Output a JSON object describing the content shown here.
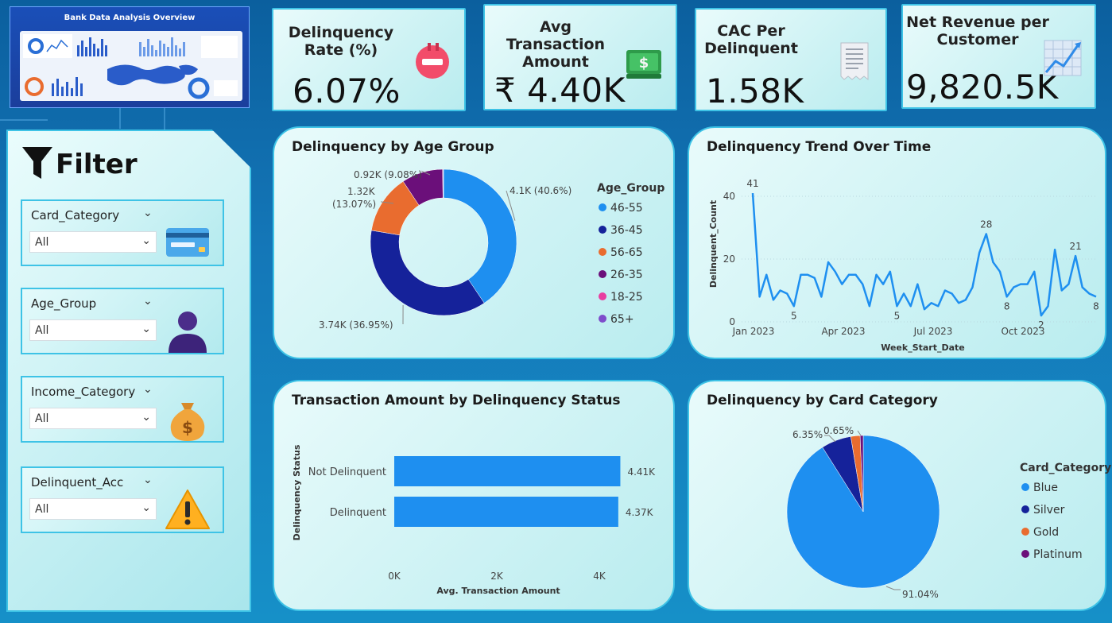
{
  "colors": {
    "blue": "#1e8ff0",
    "navy": "#15229a",
    "orange": "#e96c2f",
    "purple": "#6b0f7a",
    "pink": "#e83ea0",
    "violet": "#7e4ccb",
    "line": "#1e8ff0"
  },
  "thumbnail": {
    "title": "Bank Data Analysis Overview"
  },
  "kpis": [
    {
      "title": "Delinquency Rate (%)",
      "value": "6.07%",
      "icon": "calendar-remove-icon"
    },
    {
      "title": "Avg Transaction Amount",
      "value": "₹ 4.40K",
      "icon": "money-icon"
    },
    {
      "title": "CAC Per Delinquent",
      "value": "1.58K",
      "icon": "receipt-icon"
    },
    {
      "title": "Net Revenue per Customer",
      "value": "9,820.5K",
      "icon": "growth-chart-icon"
    }
  ],
  "filter": {
    "title": "Filter",
    "slicers": [
      {
        "label": "Card_Category",
        "value": "All",
        "icon": "credit-card-icon"
      },
      {
        "label": "Age_Group",
        "value": "All",
        "icon": "person-icon"
      },
      {
        "label": "Income_Category",
        "value": "All",
        "icon": "money-bag-icon"
      },
      {
        "label": "Delinquent_Acc",
        "value": "All",
        "icon": "warning-icon"
      }
    ]
  },
  "chart_data": [
    {
      "type": "donut",
      "title": "Delinquency by Age Group",
      "legend_title": "Age_Group",
      "legend_position": "right",
      "categories": [
        "46-55",
        "36-45",
        "56-65",
        "26-35",
        "18-25",
        "65+"
      ],
      "values": [
        4.1,
        3.74,
        1.32,
        0.92,
        0.01,
        0.01
      ],
      "value_unit": "K",
      "labels": [
        "4.1K (40.6%)",
        "3.74K (36.95%)",
        "1.32K (13.07%)",
        "0.92K (9.08%)",
        "",
        ""
      ],
      "colors": [
        "#1e8ff0",
        "#15229a",
        "#e96c2f",
        "#6b0f7a",
        "#e83ea0",
        "#7e4ccb"
      ]
    },
    {
      "type": "line",
      "title": "Delinquency Trend Over Time",
      "xlabel": "Week_Start_Date",
      "ylabel": "Delinquent_Count",
      "x_ticks": [
        "Jan 2023",
        "Apr 2023",
        "Jul 2023",
        "Oct 2023"
      ],
      "y_ticks": [
        "0",
        "20",
        "40"
      ],
      "ylim": [
        0,
        45
      ],
      "values": [
        41,
        8,
        15,
        7,
        10,
        9,
        5,
        15,
        15,
        14,
        8,
        19,
        16,
        12,
        15,
        15,
        12,
        5,
        15,
        12,
        16,
        5,
        9,
        5,
        12,
        4,
        6,
        5,
        10,
        9,
        6,
        7,
        11,
        22,
        28,
        19,
        16,
        8,
        11,
        12,
        12,
        16,
        2,
        5,
        23,
        10,
        12,
        21,
        11,
        9,
        8
      ],
      "point_labels": [
        {
          "index": 0,
          "text": "41"
        },
        {
          "index": 6,
          "text": "5"
        },
        {
          "index": 21,
          "text": "5"
        },
        {
          "index": 34,
          "text": "28"
        },
        {
          "index": 37,
          "text": "8"
        },
        {
          "index": 42,
          "text": "2"
        },
        {
          "index": 47,
          "text": "21"
        },
        {
          "index": 50,
          "text": "8"
        }
      ]
    },
    {
      "type": "bar",
      "orientation": "horizontal",
      "title": "Transaction Amount by Delinquency Status",
      "xlabel": "Avg. Transaction Amount",
      "ylabel": "Delinquency Status",
      "categories": [
        "Not Delinquent",
        "Delinquent"
      ],
      "values": [
        4.41,
        4.37
      ],
      "value_unit": "K",
      "data_labels": [
        "4.41K",
        "4.37K"
      ],
      "x_ticks": [
        "0K",
        "2K",
        "4K"
      ],
      "xlim": [
        0,
        4.5
      ]
    },
    {
      "type": "pie",
      "title": "Delinquency by Card Category",
      "legend_title": "Card_Category",
      "legend_position": "right",
      "categories": [
        "Blue",
        "Silver",
        "Gold",
        "Platinum"
      ],
      "values": [
        91.04,
        6.35,
        1.96,
        0.65
      ],
      "labels": [
        "91.04%",
        "6.35%",
        "",
        "0.65%"
      ],
      "colors": [
        "#1e8ff0",
        "#15229a",
        "#e96c2f",
        "#6b0f7a"
      ]
    }
  ]
}
